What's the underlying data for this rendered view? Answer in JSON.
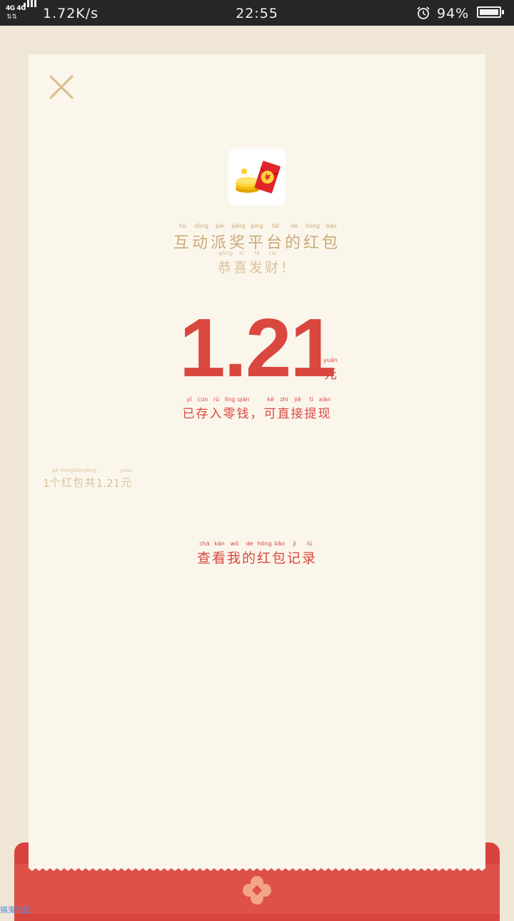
{
  "status_bar": {
    "network": "4G 4G",
    "speed": "1.72K/s",
    "time": "22:55",
    "battery_percent": "94%",
    "battery_level": 0.94
  },
  "header": {
    "close_icon": "close-icon"
  },
  "envelope": {
    "icon": "red-envelope-coins-icon",
    "title_chars": [
      "互",
      "动",
      "派",
      "奖",
      "平",
      "台",
      "的",
      "红",
      "包"
    ],
    "title_pinyin": [
      "hù",
      "dòng",
      "pài",
      "jiǎng",
      "píng",
      "tái",
      "de",
      "hóng",
      "bāo"
    ],
    "subtitle_chars": [
      "恭",
      "喜",
      "发",
      "财",
      "！"
    ],
    "subtitle_pinyin": [
      "gōng",
      "xǐ",
      "fā",
      "cái",
      ""
    ],
    "amount": "1.21",
    "unit": "元",
    "unit_pinyin": "yuán",
    "saved_chars": [
      "已",
      "存",
      "入",
      "零",
      "钱",
      "，",
      "可",
      "直",
      "接",
      "提",
      "现"
    ],
    "saved_pinyin": [
      "yǐ",
      "cún",
      "rù",
      "líng",
      "qián",
      "",
      "kě",
      "zhí",
      "jiē",
      "tí",
      "xiàn"
    ],
    "count_chars": [
      "1",
      "个",
      "红",
      "包",
      "共",
      "1.21",
      "元"
    ],
    "count_pinyin": [
      "",
      "gè",
      "hóng",
      "bāo",
      "gòng",
      "",
      "yuán"
    ],
    "records_chars": [
      "查",
      "看",
      "我",
      "的",
      "红",
      "包",
      "记",
      "录"
    ],
    "records_pinyin": [
      "chá",
      "kàn",
      "wǒ",
      "de",
      "hóng",
      "bāo",
      "jì",
      "lù"
    ]
  },
  "footer": {
    "emblem_icon": "flower-emblem-icon",
    "watermark": "搞鬼社区"
  },
  "colors": {
    "accent_red": "#d9473f",
    "gold": "#c9aa7a",
    "paper": "#fbf6ec"
  }
}
